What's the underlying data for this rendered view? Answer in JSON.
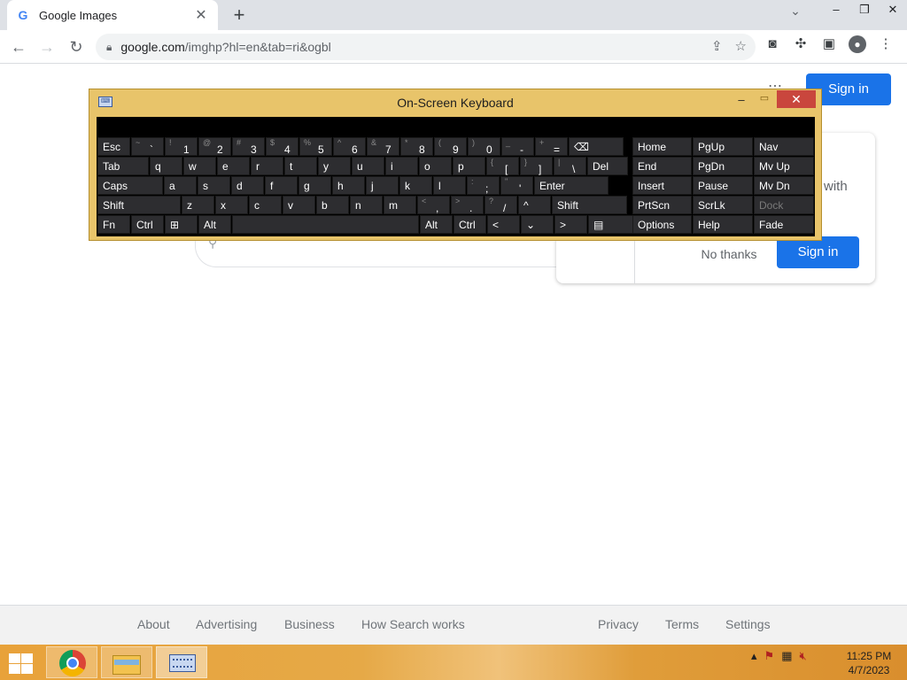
{
  "browser": {
    "tab_title": "Google Images",
    "tab_favicon": "G",
    "url_host": "google.com",
    "url_path": "/imghp?hl=en&tab=ri&ogbl"
  },
  "page": {
    "header_signin": "Sign in",
    "promo_with": "with",
    "promo_no_thanks": "No thanks",
    "promo_signin": "Sign in",
    "footer_links": [
      "About",
      "Advertising",
      "Business",
      "How Search works",
      "Privacy",
      "Terms",
      "Settings"
    ]
  },
  "osk": {
    "title": "On-Screen Keyboard",
    "rows": [
      [
        [
          "Esc",
          ""
        ],
        [
          "`",
          "~"
        ],
        [
          "1",
          "!"
        ],
        [
          "2",
          "@"
        ],
        [
          "3",
          "#"
        ],
        [
          "4",
          "$"
        ],
        [
          "5",
          "%"
        ],
        [
          "6",
          "^"
        ],
        [
          "7",
          "&"
        ],
        [
          "8",
          "*"
        ],
        [
          "9",
          "("
        ],
        [
          "0",
          ")"
        ],
        [
          "-",
          "_"
        ],
        [
          "=",
          "+"
        ],
        [
          "⌫",
          ""
        ]
      ],
      [
        [
          "Tab",
          ""
        ],
        [
          "q",
          ""
        ],
        [
          "w",
          ""
        ],
        [
          "e",
          ""
        ],
        [
          "r",
          ""
        ],
        [
          "t",
          ""
        ],
        [
          "y",
          ""
        ],
        [
          "u",
          ""
        ],
        [
          "i",
          ""
        ],
        [
          "o",
          ""
        ],
        [
          "p",
          ""
        ],
        [
          "[",
          "{"
        ],
        [
          "]",
          "}"
        ],
        [
          "\\",
          "|"
        ],
        [
          "Del",
          ""
        ]
      ],
      [
        [
          "Caps",
          ""
        ],
        [
          "a",
          ""
        ],
        [
          "s",
          ""
        ],
        [
          "d",
          ""
        ],
        [
          "f",
          ""
        ],
        [
          "g",
          ""
        ],
        [
          "h",
          ""
        ],
        [
          "j",
          ""
        ],
        [
          "k",
          ""
        ],
        [
          "l",
          ""
        ],
        [
          ";",
          ":"
        ],
        [
          "'",
          "\""
        ],
        [
          "Enter",
          ""
        ]
      ],
      [
        [
          "Shift",
          ""
        ],
        [
          "z",
          ""
        ],
        [
          "x",
          ""
        ],
        [
          "c",
          ""
        ],
        [
          "v",
          ""
        ],
        [
          "b",
          ""
        ],
        [
          "n",
          ""
        ],
        [
          "m",
          ""
        ],
        [
          ",",
          "<"
        ],
        [
          ".",
          ">"
        ],
        [
          "/",
          "?"
        ],
        [
          "^",
          ""
        ],
        [
          "Shift",
          ""
        ]
      ],
      [
        [
          "Fn",
          ""
        ],
        [
          "Ctrl",
          ""
        ],
        [
          "⊞",
          ""
        ],
        [
          "Alt",
          ""
        ],
        [
          "",
          ""
        ],
        [
          "Alt",
          ""
        ],
        [
          "Ctrl",
          ""
        ],
        [
          "<",
          ""
        ],
        [
          "⌄",
          ""
        ],
        [
          ">",
          ""
        ],
        [
          "▤",
          ""
        ]
      ]
    ],
    "nav": [
      [
        "Home",
        "PgUp",
        "Nav"
      ],
      [
        "End",
        "PgDn",
        "Mv Up"
      ],
      [
        "Insert",
        "Pause",
        "Mv Dn"
      ],
      [
        "PrtScn",
        "ScrLk",
        "Dock"
      ],
      [
        "Options",
        "Help",
        "Fade"
      ]
    ]
  },
  "taskbar": {
    "time": "11:25 PM",
    "date": "4/7/2023"
  }
}
